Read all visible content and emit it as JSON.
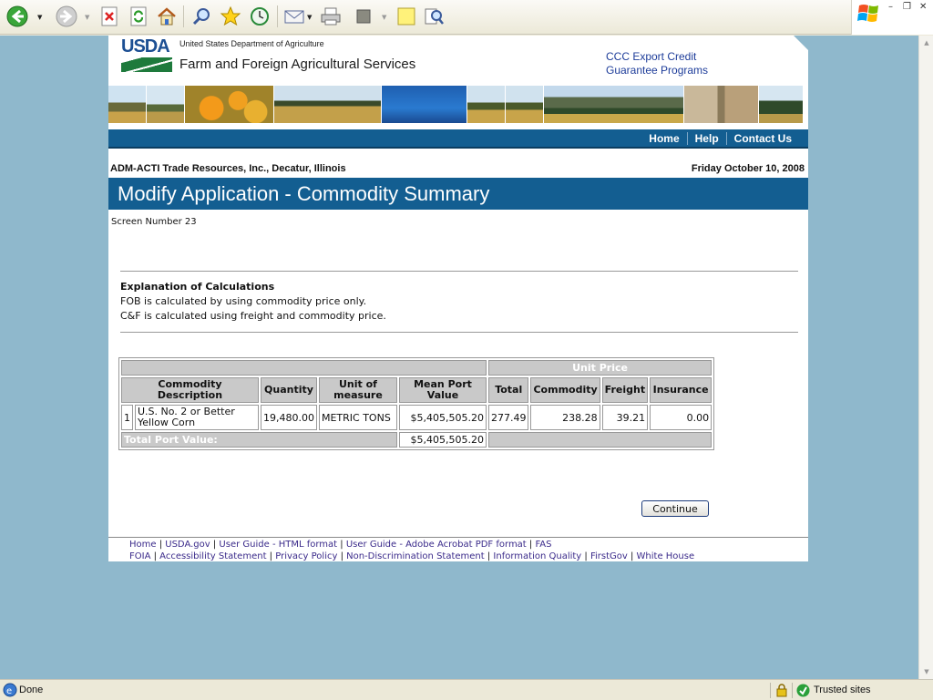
{
  "browser": {
    "toolbar_icons": [
      "back-icon",
      "forward-icon",
      "stop-icon",
      "refresh-icon",
      "home-icon",
      "search-icon",
      "favorites-icon",
      "history-icon",
      "mail-icon",
      "print-icon",
      "edit-icon",
      "discuss-icon",
      "research-icon"
    ],
    "status_text": "Done",
    "zone_text": "Trusted sites"
  },
  "header": {
    "logo_text": "USDA",
    "department": "United States Department of Agriculture",
    "site_title": "Farm and Foreign Agricultural Services",
    "program_line1": "CCC Export Credit",
    "program_line2": "Guarantee Programs"
  },
  "nav": {
    "home": "Home",
    "help": "Help",
    "contact": "Contact Us"
  },
  "context": {
    "organization": "ADM-ACTI Trade Resources, Inc., Decatur, Illinois",
    "date": "Friday October 10, 2008"
  },
  "page": {
    "title": "Modify Application - Commodity Summary",
    "screen_number": "Screen Number 23"
  },
  "explanation": {
    "heading": "Explanation of Calculations",
    "line1": "FOB is calculated by using commodity price only.",
    "line2": "C&F is calculated using freight and commodity price."
  },
  "table": {
    "group_header": "Unit Price",
    "headers": {
      "commodity": "Commodity Description",
      "quantity": "Quantity",
      "unit": "Unit of measure",
      "mean_port_value": "Mean Port Value",
      "total": "Total",
      "commodity_price": "Commodity",
      "freight": "Freight",
      "insurance": "Insurance"
    },
    "rows": [
      {
        "index": "1",
        "commodity": "U.S. No. 2 or Better Yellow Corn",
        "quantity": "19,480.00",
        "unit": "METRIC TONS",
        "mean_port_value": "$5,405,505.20",
        "total": "277.49",
        "commodity_price": "238.28",
        "freight": "39.21",
        "insurance": "0.00"
      }
    ],
    "total_label": "Total Port Value:",
    "total_value": "$5,405,505.20"
  },
  "buttons": {
    "continue": "Continue"
  },
  "footer": {
    "line1": [
      "Home",
      "USDA.gov",
      "User Guide - HTML format",
      "User Guide - Adobe Acrobat PDF format",
      "FAS"
    ],
    "line2": [
      "FOIA",
      "Accessibility Statement",
      "Privacy Policy",
      "Non-Discrimination Statement",
      "Information Quality",
      "FirstGov",
      "White House"
    ]
  }
}
